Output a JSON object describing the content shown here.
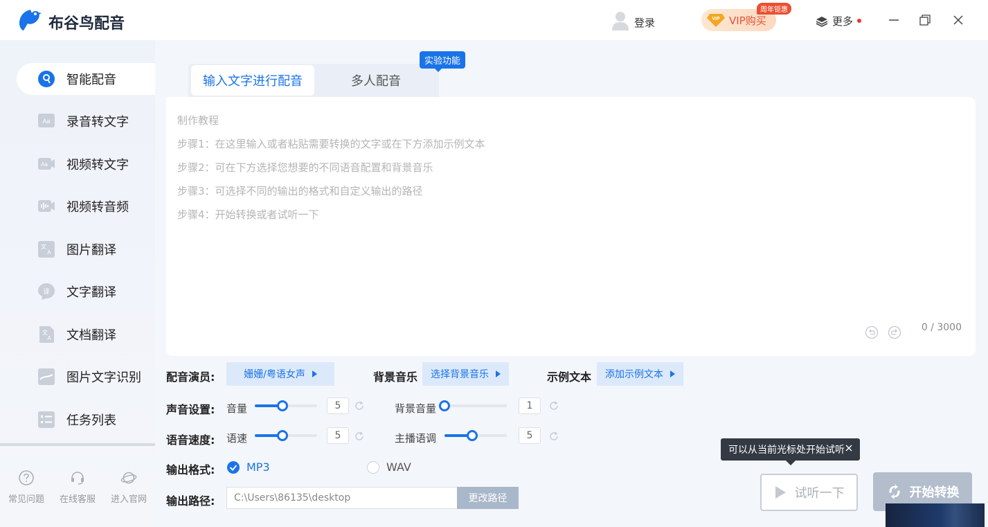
{
  "app": {
    "title": "布谷鸟配音",
    "logo_icon": "bird-logo-icon"
  },
  "header": {
    "login_label": "登录",
    "vip_label": "VIP购买",
    "vip_badge": "周年钜惠",
    "more_label": "更多",
    "window_controls": [
      "minimize-icon",
      "maximize-icon",
      "close-icon"
    ]
  },
  "sidebar": {
    "items": [
      {
        "label": "智能配音",
        "icon": "smart-dub-icon",
        "active": true
      },
      {
        "label": "录音转文字",
        "icon": "audio-to-text-icon",
        "active": false
      },
      {
        "label": "视频转文字",
        "icon": "video-to-text-icon",
        "active": false
      },
      {
        "label": "视频转音频",
        "icon": "video-to-audio-icon",
        "active": false
      },
      {
        "label": "图片翻译",
        "icon": "image-translate-icon",
        "active": false
      },
      {
        "label": "文字翻译",
        "icon": "text-translate-icon",
        "active": false
      },
      {
        "label": "文档翻译",
        "icon": "document-translate-icon",
        "active": false
      },
      {
        "label": "图片文字识别",
        "icon": "ocr-icon",
        "active": false
      },
      {
        "label": "任务列表",
        "icon": "task-list-icon",
        "active": false
      }
    ],
    "footer": [
      {
        "label": "常见问题",
        "icon": "faq-icon"
      },
      {
        "label": "在线客服",
        "icon": "support-icon"
      },
      {
        "label": "进入官网",
        "icon": "website-icon"
      }
    ]
  },
  "tabs": [
    {
      "label": "输入文字进行配音",
      "active": true
    },
    {
      "label": "多人配音",
      "active": false
    }
  ],
  "experimental_badge": "实验功能",
  "editor": {
    "lines": [
      "制作教程",
      "步骤1：在这里输入或者粘贴需要转换的文字或在下方添加示例文本",
      "步骤2：可在下方选择您想要的不同语音配置和背景音乐",
      "步骤3：可选择不同的输出的格式和自定义输出的路径",
      "步骤4：开始转换或者试听一下"
    ],
    "counter": "0 / 3000"
  },
  "voice": {
    "label": "配音演员:",
    "value": "姗姗/粤语女声"
  },
  "bgm": {
    "label": "背景音乐",
    "value": "选择背景音乐"
  },
  "sample": {
    "label": "示例文本",
    "value": "添加示例文本"
  },
  "sound_settings": {
    "label": "声音设置:",
    "volume": {
      "label": "音量",
      "value": "5",
      "fraction": 0.44
    },
    "bg_volume": {
      "label": "背景音量",
      "value": "1",
      "fraction": 0.0
    }
  },
  "speech_speed": {
    "label": "语音速度:",
    "speed": {
      "label": "语速",
      "value": "5",
      "fraction": 0.44
    },
    "pitch": {
      "label": "主播语调",
      "value": "5",
      "fraction": 0.44
    }
  },
  "output_format": {
    "label": "输出格式:",
    "options": [
      "MP3",
      "WAV"
    ],
    "selected": "MP3"
  },
  "output_path": {
    "label": "输出路径:",
    "value": "C:\\Users\\86135\\desktop",
    "button": "更改路径"
  },
  "tooltip": {
    "text": "可以从当前光标处开始试听"
  },
  "actions": {
    "listen": "试听一下",
    "start": "开始转换"
  },
  "colors": {
    "accent": "#1a73e8",
    "vip": "#e5533b",
    "disabled_button": "#b3bdcc"
  }
}
